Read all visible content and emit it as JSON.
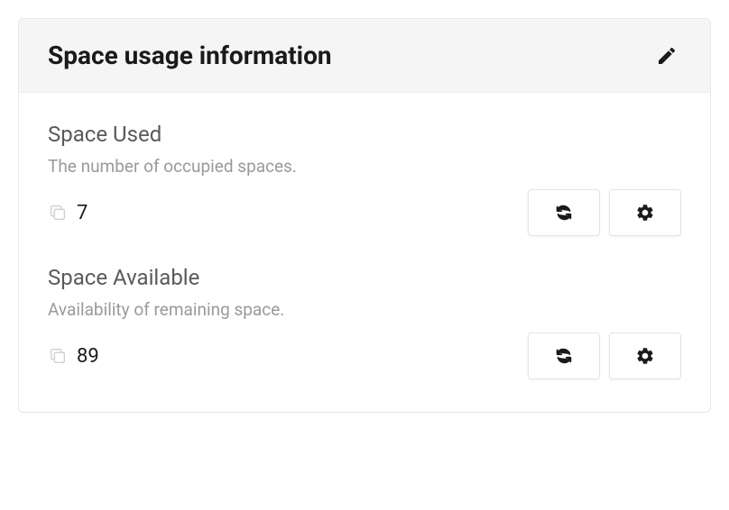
{
  "card": {
    "title": "Space usage information"
  },
  "metrics": [
    {
      "title": "Space Used",
      "description": "The number of occupied spaces.",
      "value": "7"
    },
    {
      "title": "Space Available",
      "description": "Availability of remaining space.",
      "value": "89"
    }
  ]
}
